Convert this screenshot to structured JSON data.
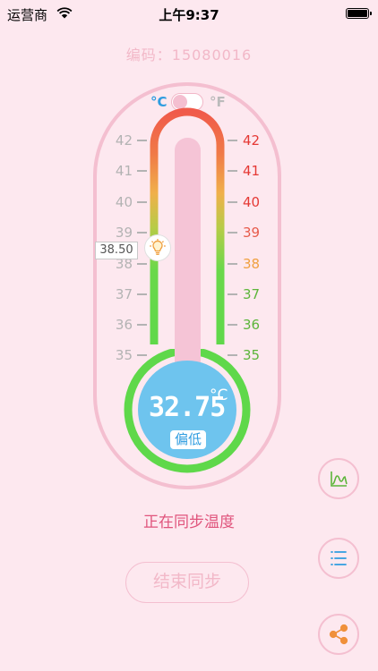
{
  "status_bar": {
    "carrier": "运营商",
    "time": "上午9:37"
  },
  "device": {
    "code_text": "编码：15080016"
  },
  "unit_toggle": {
    "celsius": "°C",
    "fahrenheit": "°F",
    "selected": "celsius"
  },
  "scale": {
    "left": [
      "42",
      "41",
      "40",
      "39",
      "38",
      "37",
      "36",
      "35"
    ],
    "right": [
      "42",
      "41",
      "40",
      "39",
      "38",
      "37",
      "36",
      "35"
    ],
    "right_colors": [
      "#e53935",
      "#e53935",
      "#e53935",
      "#e75b4b",
      "#f0a040",
      "#5cb53a",
      "#5cb53a",
      "#5cb53a"
    ]
  },
  "alarm_pointer": {
    "value": "38.50"
  },
  "reading": {
    "value": "32.75",
    "unit": "°C",
    "status": "偏低"
  },
  "sync": {
    "status_text": "正在同步温度",
    "end_button": "结束同步"
  },
  "side_actions": {
    "chart": "chart-icon",
    "list": "list-icon",
    "share": "share-icon"
  },
  "colors": {
    "background": "#fde8ef",
    "accent_pink": "#f4bfd0",
    "bulb_blue": "#6ec4ee",
    "ring_green": "#5fd84a"
  }
}
